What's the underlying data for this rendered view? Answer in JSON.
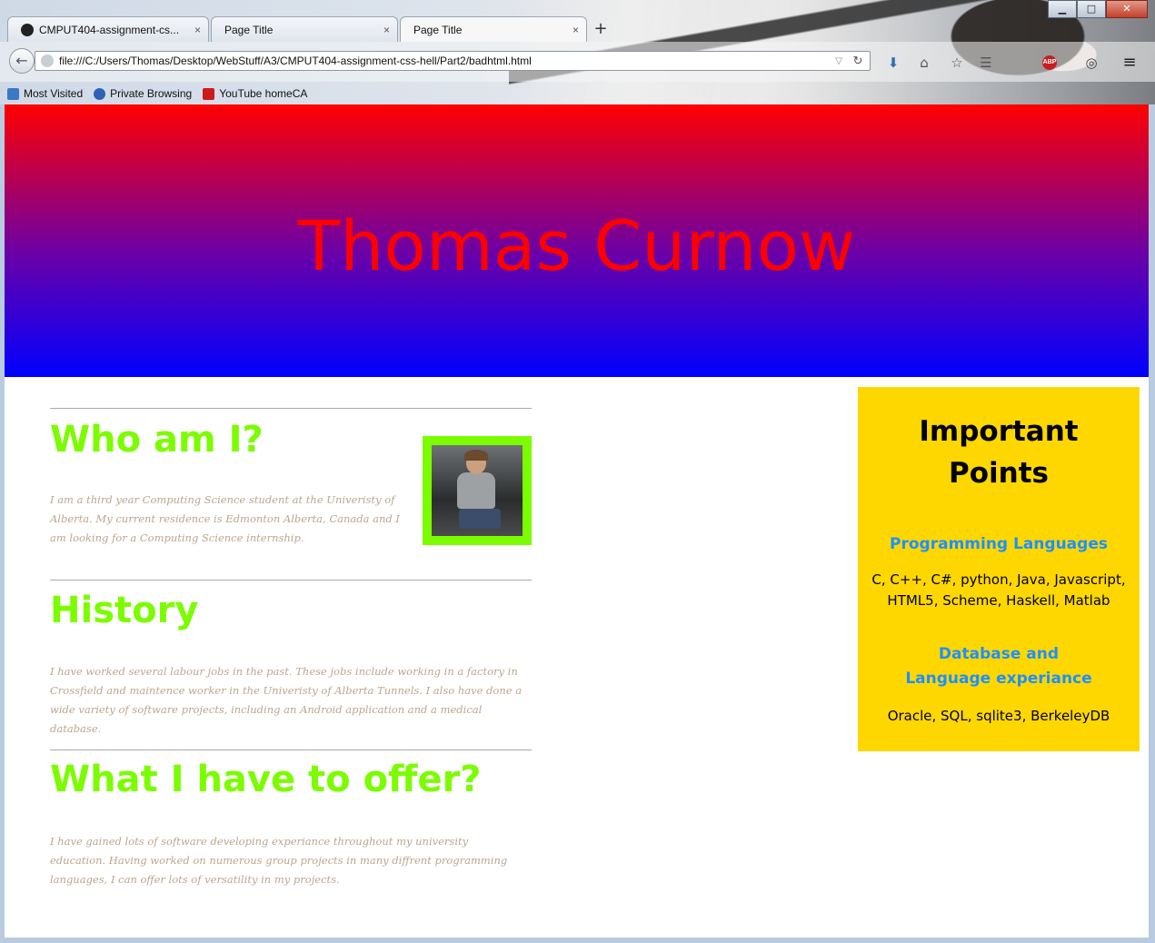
{
  "browser": {
    "tabs": [
      {
        "label": "CMPUT404-assignment-cs...",
        "icon": "github-icon"
      },
      {
        "label": "Page Title"
      },
      {
        "label": "Page Title",
        "active": true
      }
    ],
    "new_tab_symbol": "+",
    "tab_close_symbol": "×",
    "url": "file:///C:/Users/Thomas/Desktop/WebStuff/A3/CMPUT404-assignment-css-hell/Part2/badhtml.html",
    "bookmarks": [
      {
        "label": "Most Visited",
        "icon": "most-visited-icon"
      },
      {
        "label": "Private Browsing",
        "icon": "help-icon"
      },
      {
        "label": "YouTube homeCA",
        "icon": "youtube-icon"
      }
    ],
    "window_buttons": {
      "minimize": "▁",
      "maximize": "□",
      "close": "✕"
    }
  },
  "page": {
    "title": "Thomas Curnow",
    "sections": [
      {
        "heading": "Who am I?",
        "text": "I am a third year Computing Science student at the Univeristy of Alberta. My current residence is Edmonton Alberta, Canada and I am looking for a Computing Science internship."
      },
      {
        "heading": "History",
        "text": "I have worked several labour jobs in the past. These jobs include working in a factory in Crossfield and maintence worker in the Univeristy of Alberta Tunnels. I also have done a wide variety of software projects, including an Android application and a medical database."
      },
      {
        "heading": "What I have to offer?",
        "text": "I have gained lots of software developing experiance throughout my university education. Having worked on numerous group projects in many diffrent programming languages, I can offer lots of versatility in my projects."
      }
    ],
    "aside": {
      "title": "Important Points",
      "items": [
        {
          "heading": "Programming Languages",
          "text": "C, C++, C#, python, Java, Javascript, HTML5, Scheme, Haskell, Matlab"
        },
        {
          "heading": "Database and Language experiance",
          "text": "Oracle, SQL, sqlite3, BerkeleyDB"
        }
      ]
    }
  },
  "colors": {
    "header_top": "#ff0000",
    "header_bottom": "#0000ff",
    "title_text": "#ff0000",
    "section_heading": "#7cfc00",
    "section_text": "#bda58e",
    "aside_background": "#ffd700",
    "aside_subheading": "#1e90ff"
  }
}
